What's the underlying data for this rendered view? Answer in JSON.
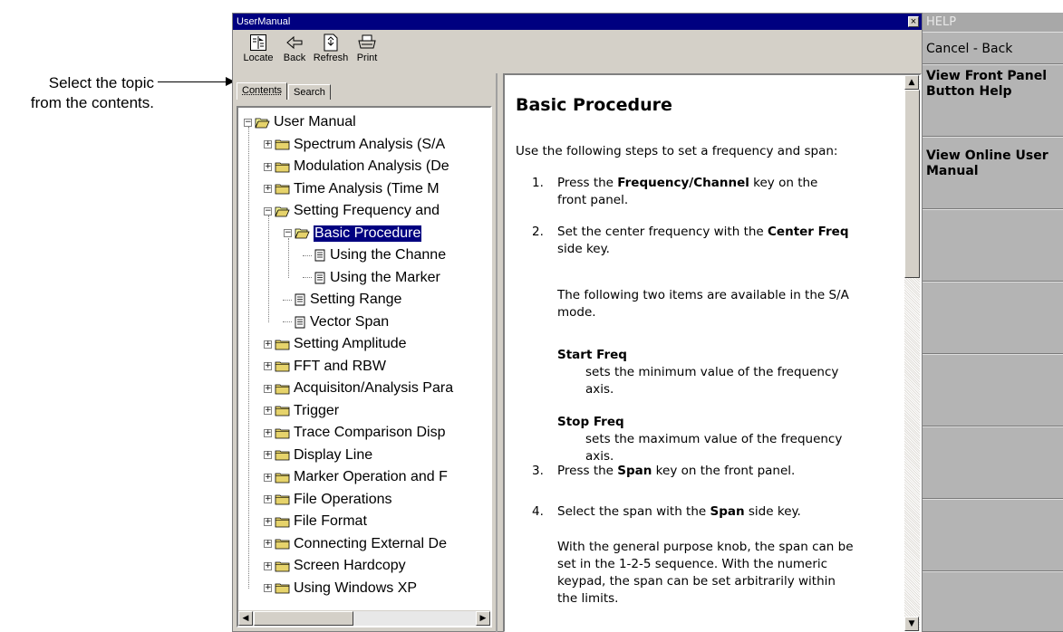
{
  "callout": {
    "line1": "Select the topic",
    "line2": "from the contents."
  },
  "window": {
    "title": "UserManual",
    "close_label": "×",
    "toolbar": [
      {
        "label": "Locate",
        "icon": "locate-icon"
      },
      {
        "label": "Back",
        "icon": "back-arrow-icon"
      },
      {
        "label": "Refresh",
        "icon": "refresh-icon"
      },
      {
        "label": "Print",
        "icon": "printer-icon"
      }
    ]
  },
  "tabs": {
    "contents": "Contents",
    "search": "Search"
  },
  "tree": [
    {
      "label": "User Manual",
      "depth": 0,
      "type": "folder-open",
      "expander": "−"
    },
    {
      "label": "Spectrum Analysis (S/A",
      "depth": 1,
      "type": "folder",
      "expander": "+"
    },
    {
      "label": "Modulation Analysis (De",
      "depth": 1,
      "type": "folder",
      "expander": "+"
    },
    {
      "label": "Time Analysis (Time M",
      "depth": 1,
      "type": "folder",
      "expander": "+"
    },
    {
      "label": "Setting Frequency and",
      "depth": 1,
      "type": "folder-open",
      "expander": "−"
    },
    {
      "label": "Basic Procedure",
      "depth": 2,
      "type": "folder-open",
      "expander": "−",
      "selected": true
    },
    {
      "label": "Using the Channe",
      "depth": 3,
      "type": "doc"
    },
    {
      "label": "Using the Marker",
      "depth": 3,
      "type": "doc"
    },
    {
      "label": "Setting Range",
      "depth": 2,
      "type": "doc"
    },
    {
      "label": "Vector Span",
      "depth": 2,
      "type": "doc"
    },
    {
      "label": "Setting Amplitude",
      "depth": 1,
      "type": "folder",
      "expander": "+"
    },
    {
      "label": "FFT and RBW",
      "depth": 1,
      "type": "folder",
      "expander": "+"
    },
    {
      "label": "Acquisiton/Analysis Para",
      "depth": 1,
      "type": "folder",
      "expander": "+"
    },
    {
      "label": "Trigger",
      "depth": 1,
      "type": "folder",
      "expander": "+"
    },
    {
      "label": "Trace Comparison Disp",
      "depth": 1,
      "type": "folder",
      "expander": "+"
    },
    {
      "label": "Display Line",
      "depth": 1,
      "type": "folder",
      "expander": "+"
    },
    {
      "label": "Marker Operation and F",
      "depth": 1,
      "type": "folder",
      "expander": "+"
    },
    {
      "label": "File Operations",
      "depth": 1,
      "type": "folder",
      "expander": "+"
    },
    {
      "label": "File Format",
      "depth": 1,
      "type": "folder",
      "expander": "+"
    },
    {
      "label": "Connecting External De",
      "depth": 1,
      "type": "folder",
      "expander": "+"
    },
    {
      "label": "Screen Hardcopy",
      "depth": 1,
      "type": "folder",
      "expander": "+"
    },
    {
      "label": "Using Windows XP",
      "depth": 1,
      "type": "folder",
      "expander": "+"
    }
  ],
  "content": {
    "heading": "Basic Procedure",
    "intro": "Use the following steps to set a frequency and span:",
    "step1": {
      "num": "1.",
      "a": "Press the ",
      "b": "Frequency/Channel",
      "c": " key on the",
      "d": "front panel."
    },
    "step2": {
      "num": "2.",
      "a": "Set the center frequency with the ",
      "b": "Center Freq",
      "c": "side key."
    },
    "step2_note": {
      "l1": "The following two items are available in the S/A",
      "l2": "mode."
    },
    "start_freq": {
      "term": "Start Freq",
      "l1": "sets the minimum value of the frequency",
      "l2": "axis."
    },
    "stop_freq": {
      "term": "Stop Freq",
      "l1": "sets the maximum value of the frequency",
      "l2": "axis."
    },
    "step3": {
      "num": "3.",
      "a": "Press the ",
      "b": "Span",
      "c": " key on the front panel."
    },
    "step4": {
      "num": "4.",
      "a": "Select the span with the ",
      "b": "Span",
      "c": " side key."
    },
    "step4_note": {
      "l1": "With the general purpose knob, the span can be",
      "l2": "set in the 1-2-5 sequence. With the numeric",
      "l3": "keypad, the span can be set arbitrarily within",
      "l4": "the limits."
    }
  },
  "menu": {
    "title": "HELP",
    "cancel_back": "Cancel - Back",
    "front_panel_help": "View Front Panel Button Help",
    "online_manual": "View Online User Manual"
  }
}
